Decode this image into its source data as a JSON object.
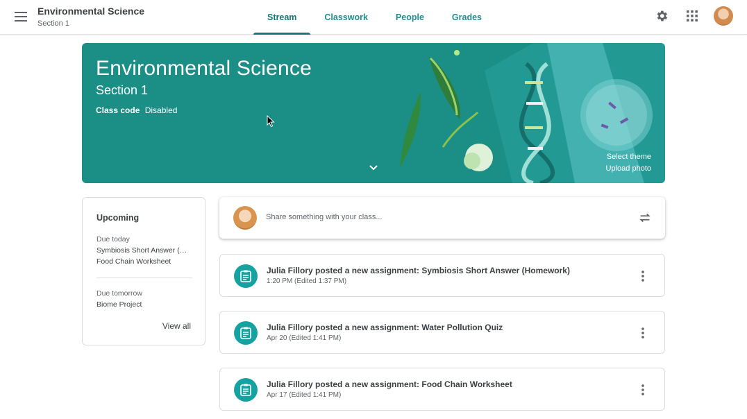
{
  "header": {
    "title": "Environmental Science",
    "section": "Section 1",
    "tabs": [
      {
        "label": "Stream",
        "active": true
      },
      {
        "label": "Classwork",
        "active": false
      },
      {
        "label": "People",
        "active": false
      },
      {
        "label": "Grades",
        "active": false
      }
    ],
    "icons": [
      "menu-icon",
      "gear-icon",
      "apps-grid-icon",
      "avatar"
    ]
  },
  "banner": {
    "title": "Environmental Science",
    "section": "Section 1",
    "class_code_label": "Class code",
    "class_code_value": "Disabled",
    "select_theme": "Select theme",
    "upload_photo": "Upload photo",
    "color": "#1b8f86"
  },
  "upcoming": {
    "title": "Upcoming",
    "groups": [
      {
        "label": "Due today",
        "items": [
          "Symbiosis Short Answer (Homework)",
          "Food Chain Worksheet"
        ]
      },
      {
        "label": "Due tomorrow",
        "items": [
          "Biome Project"
        ]
      }
    ],
    "view_all": "View all"
  },
  "share": {
    "placeholder": "Share something with your class..."
  },
  "posts": [
    {
      "text": "Julia Fillory posted a new assignment: Symbiosis Short Answer (Homework)",
      "time": "1:20 PM (Edited 1:37 PM)"
    },
    {
      "text": "Julia Fillory posted a new assignment: Water Pollution Quiz",
      "time": "Apr 20 (Edited 1:41 PM)"
    },
    {
      "text": "Julia Fillory posted a new assignment: Food Chain Worksheet",
      "time": "Apr 17 (Edited 1:41 PM)"
    }
  ],
  "colors": {
    "accent": "#137a75",
    "assignment_icon": "#17a2a2"
  }
}
